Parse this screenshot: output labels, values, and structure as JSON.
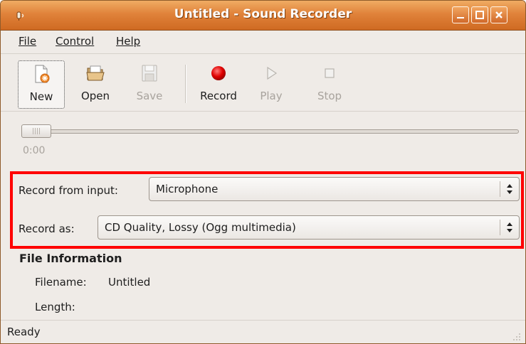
{
  "window": {
    "title": "Untitled - Sound Recorder"
  },
  "menu": {
    "file": "File",
    "control": "Control",
    "help": "Help"
  },
  "toolbar": {
    "new_label": "New",
    "open_label": "Open",
    "save_label": "Save",
    "record_label": "Record",
    "play_label": "Play",
    "stop_label": "Stop"
  },
  "position": {
    "time": "0:00",
    "fraction": 0
  },
  "input": {
    "record_from_label": "Record from input:",
    "record_from_value": "Microphone",
    "record_as_label": "Record as:",
    "record_as_value": "CD Quality, Lossy (Ogg multimedia)"
  },
  "file_info": {
    "title": "File Information",
    "filename_label": "Filename:",
    "filename_value": "Untitled",
    "length_label": "Length:",
    "length_value": ""
  },
  "status": {
    "text": "Ready"
  },
  "colors": {
    "titlebar": "#d8762f",
    "highlight": "#ff0000",
    "record": "#e00000"
  },
  "icons": [
    "app-icon",
    "minimize-icon",
    "maximize-icon",
    "close-icon",
    "new-file-icon",
    "open-folder-icon",
    "save-disk-icon",
    "record-icon",
    "play-icon",
    "stop-icon",
    "combo-arrows-icon",
    "resize-grip-icon"
  ]
}
